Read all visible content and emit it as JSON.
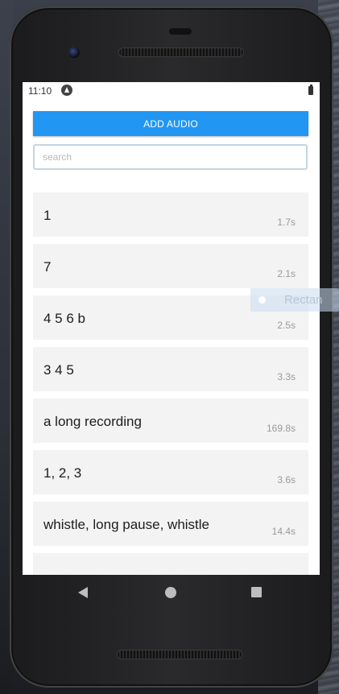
{
  "status_bar": {
    "time": "11:10"
  },
  "toolbar": {
    "add_audio_label": "ADD AUDIO"
  },
  "search": {
    "placeholder": "search",
    "value": ""
  },
  "recordings": [
    {
      "title": "1",
      "duration": "1.7s"
    },
    {
      "title": "7",
      "duration": "2.1s"
    },
    {
      "title": "4 5 6 b",
      "duration": "2.5s"
    },
    {
      "title": "3 4 5",
      "duration": "3.3s"
    },
    {
      "title": "a long recording",
      "duration": "169.8s"
    },
    {
      "title": "1, 2, 3",
      "duration": "3.6s"
    },
    {
      "title": "whistle, long pause, whistle",
      "duration": "14.4s"
    },
    {
      "title": "",
      "duration": ""
    }
  ],
  "overlay": {
    "label": "Rectan"
  },
  "colors": {
    "accent": "#2196f3",
    "list_item_bg": "#f3f3f3",
    "duration_text": "#9a9a9a"
  },
  "icons": {
    "status_app": "android-app-icon",
    "battery": "battery-icon",
    "nav_back": "back-triangle-icon",
    "nav_home": "home-circle-icon",
    "nav_recent": "recent-apps-square-icon"
  }
}
